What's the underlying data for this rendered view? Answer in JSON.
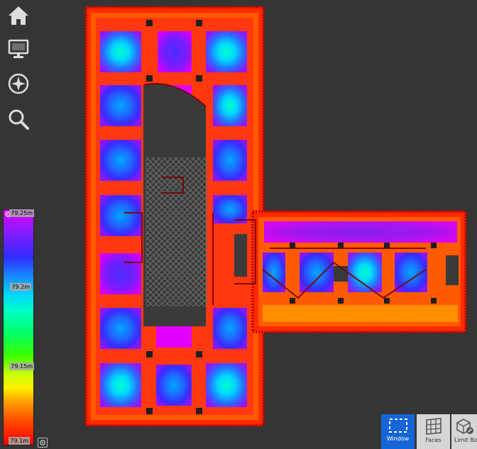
{
  "sidebar": {
    "items": [
      {
        "icon": "home-icon",
        "label": "Home"
      },
      {
        "icon": "monitor-icon",
        "label": "Display"
      },
      {
        "icon": "compass-icon",
        "label": "Navigate"
      },
      {
        "icon": "search-icon",
        "label": "Search"
      }
    ]
  },
  "legend": {
    "max_label": "79.25m",
    "mid_label": "79.2m",
    "low_label": "79.15m",
    "min_label": "79.1m",
    "colors": [
      "#e000ff",
      "#2f2bff",
      "#00d6ff",
      "#00ff6a",
      "#c9ff00",
      "#ff9a00",
      "#ff0000"
    ]
  },
  "toolbar": {
    "window_label": "Window",
    "faces_label": "Faces",
    "limit_box_label": "Limit Bo",
    "active_color": "#1565d8"
  }
}
